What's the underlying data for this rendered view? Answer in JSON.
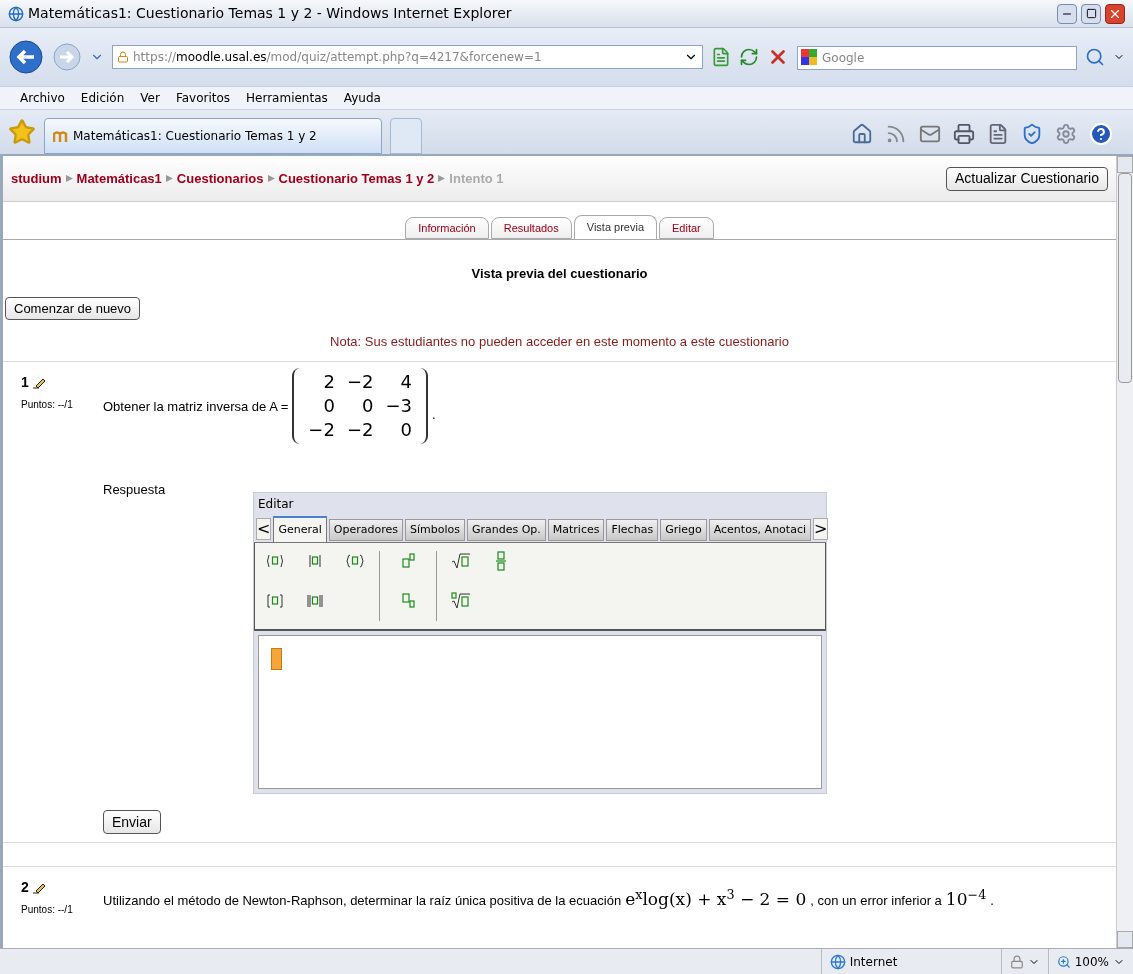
{
  "window": {
    "title": "Matemáticas1: Cuestionario Temas 1 y 2 - Windows Internet Explorer"
  },
  "address_bar": {
    "scheme": "https://",
    "host": "moodle.usal.es",
    "path": "/mod/quiz/attempt.php?q=4217&forcenew=1"
  },
  "search": {
    "placeholder": "Google"
  },
  "menu": [
    "Archivo",
    "Edición",
    "Ver",
    "Favoritos",
    "Herramientas",
    "Ayuda"
  ],
  "browser_tabs": [
    {
      "label": "Matemáticas1: Cuestionario Temas 1 y 2",
      "selected": true
    }
  ],
  "breadcrumb": [
    {
      "label": "studium",
      "kind": "link"
    },
    {
      "label": "Matemáticas1",
      "kind": "link"
    },
    {
      "label": "Cuestionarios",
      "kind": "link"
    },
    {
      "label": "Cuestionario Temas 1 y 2",
      "kind": "link"
    },
    {
      "label": "Intento 1",
      "kind": "current"
    }
  ],
  "update_button": "Actualizar Cuestionario",
  "page_tabs": [
    {
      "label": "Información",
      "selected": false
    },
    {
      "label": "Resultados",
      "selected": false
    },
    {
      "label": "Vista previa",
      "selected": true
    },
    {
      "label": "Editar",
      "selected": false
    }
  ],
  "heading": "Vista previa del cuestionario",
  "restart_button": "Comenzar de nuevo",
  "note": "Nota: Sus estudiantes no pueden acceder en este momento a este cuestionario",
  "question_1": {
    "number": "1",
    "points": "Puntos: --/1",
    "text": "Obtener la matriz inversa de A =",
    "matrix": [
      [
        "2",
        "−2",
        "4"
      ],
      [
        "0",
        "0",
        "−3"
      ],
      [
        "−2",
        "−2",
        "0"
      ]
    ],
    "end": ".",
    "answer_label": "Respuesta",
    "editor": {
      "title": "Editar",
      "scroll_left": "<",
      "scroll_right": ">",
      "tabs": [
        {
          "label": "General",
          "selected": true
        },
        {
          "label": "Operadores",
          "selected": false
        },
        {
          "label": "Símbolos",
          "selected": false
        },
        {
          "label": "Grandes Op.",
          "selected": false
        },
        {
          "label": "Matrices",
          "selected": false
        },
        {
          "label": "Flechas",
          "selected": false
        },
        {
          "label": "Griego",
          "selected": false
        },
        {
          "label": "Acentos, Anotaci",
          "selected": false
        }
      ]
    },
    "submit_button": "Enviar"
  },
  "question_2": {
    "number": "2",
    "points": "Puntos: --/1",
    "segments": [
      {
        "kind": "text",
        "text": "Utilizando el método de Newton-Raphson, determinar la raíz única positiva de la ecuación"
      },
      {
        "kind": "math",
        "text": "e$^{x}$log(x) + x$^{3}$ − 2 = 0"
      },
      {
        "kind": "text",
        "text": ", con un error inferior a"
      },
      {
        "kind": "math",
        "text": "10$^{−4}$"
      },
      {
        "kind": "text",
        "text": "."
      }
    ]
  },
  "status_bar": {
    "zone": "Internet",
    "zoom": "100%"
  }
}
